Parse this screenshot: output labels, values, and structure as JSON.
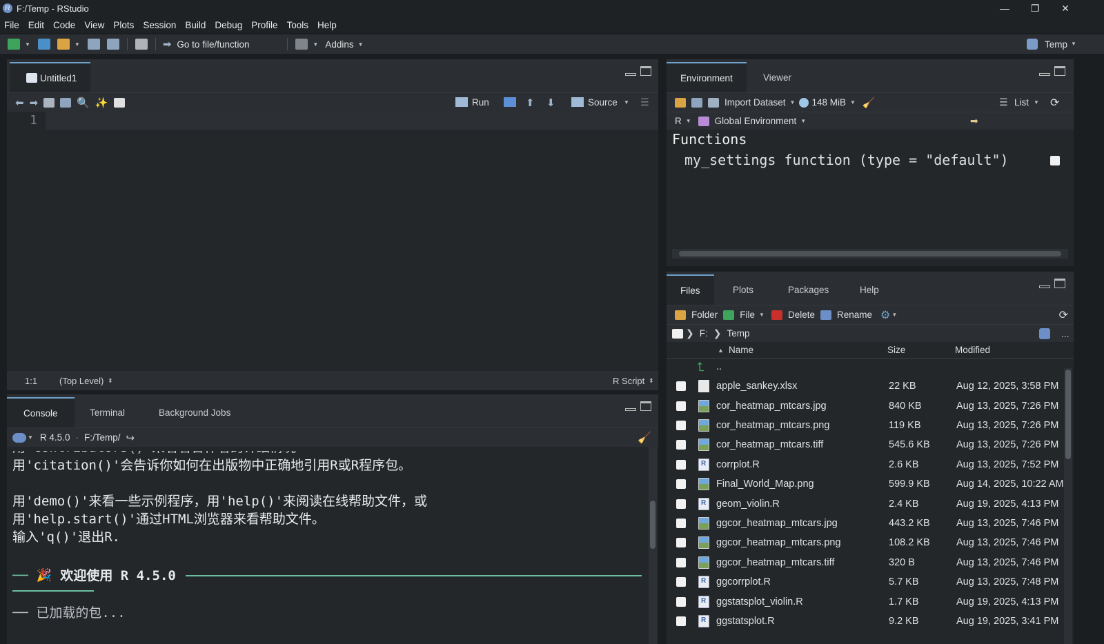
{
  "window": {
    "title": "F:/Temp - RStudio",
    "logo": "R"
  },
  "menu": [
    "File",
    "Edit",
    "Code",
    "View",
    "Plots",
    "Session",
    "Build",
    "Debug",
    "Profile",
    "Tools",
    "Help"
  ],
  "toolbar": {
    "goto_label": "Go to file/function",
    "addins_label": "Addins",
    "project_label": "Temp"
  },
  "editor": {
    "tab_label": "Untitled1",
    "run_label": "Run",
    "source_label": "Source",
    "line_number": "1",
    "cursor_pos": "1:1",
    "scope": "(Top Level)",
    "file_type": "R Script"
  },
  "console": {
    "tabs": [
      "Console",
      "Terminal",
      "Background Jobs"
    ],
    "r_version": "R 4.5.0",
    "path": "F:/Temp/",
    "lines": [
      "用'contributors()'来看看合作者的详细情况",
      "用'citation()'会告诉你如何在出版物中正确地引用R或R程序包。",
      "",
      "用'demo()'来看一些示例程序，用'help()'来阅读在线帮助文件，或",
      "用'help.start()'通过HTML浏览器来看帮助文件。",
      "输入'q()'退出R."
    ],
    "welcome_prefix": "──",
    "welcome_text": "欢迎使用 R 4.5.0",
    "welcome_icon": "party-icon",
    "last_line": "── 已加载的包..."
  },
  "environment": {
    "tabs": [
      "Environment",
      "Viewer"
    ],
    "import_label": "Import Dataset",
    "memory": "148 MiB",
    "list_label": "List",
    "lang": "R",
    "scope": "Global Environment",
    "section": "Functions",
    "row": "my_settings function (type = \"default\")"
  },
  "files": {
    "tabs": [
      "Files",
      "Plots",
      "Packages",
      "Help"
    ],
    "toolbar": {
      "folder": "Folder",
      "file": "File",
      "delete": "Delete",
      "rename": "Rename"
    },
    "breadcrumb": {
      "drive": "F:",
      "folder": "Temp"
    },
    "more": "...",
    "columns": {
      "name": "Name",
      "size": "Size",
      "modified": "Modified"
    },
    "parent": "..",
    "rows": [
      {
        "name": "apple_sankey.xlsx",
        "size": "22 KB",
        "modified": "Aug 12, 2025, 3:58 PM",
        "type": "xlsx"
      },
      {
        "name": "cor_heatmap_mtcars.jpg",
        "size": "840 KB",
        "modified": "Aug 13, 2025, 7:26 PM",
        "type": "img"
      },
      {
        "name": "cor_heatmap_mtcars.png",
        "size": "119 KB",
        "modified": "Aug 13, 2025, 7:26 PM",
        "type": "img"
      },
      {
        "name": "cor_heatmap_mtcars.tiff",
        "size": "545.6 KB",
        "modified": "Aug 13, 2025, 7:26 PM",
        "type": "img"
      },
      {
        "name": "corrplot.R",
        "size": "2.6 KB",
        "modified": "Aug 13, 2025, 7:52 PM",
        "type": "r"
      },
      {
        "name": "Final_World_Map.png",
        "size": "599.9 KB",
        "modified": "Aug 14, 2025, 10:22 AM",
        "type": "img"
      },
      {
        "name": "geom_violin.R",
        "size": "2.4 KB",
        "modified": "Aug 19, 2025, 4:13 PM",
        "type": "r"
      },
      {
        "name": "ggcor_heatmap_mtcars.jpg",
        "size": "443.2 KB",
        "modified": "Aug 13, 2025, 7:46 PM",
        "type": "img"
      },
      {
        "name": "ggcor_heatmap_mtcars.png",
        "size": "108.2 KB",
        "modified": "Aug 13, 2025, 7:46 PM",
        "type": "img"
      },
      {
        "name": "ggcor_heatmap_mtcars.tiff",
        "size": "320 B",
        "modified": "Aug 13, 2025, 7:46 PM",
        "type": "img"
      },
      {
        "name": "ggcorrplot.R",
        "size": "5.7 KB",
        "modified": "Aug 13, 2025, 7:48 PM",
        "type": "r"
      },
      {
        "name": "ggstatsplot_violin.R",
        "size": "1.7 KB",
        "modified": "Aug 19, 2025, 4:13 PM",
        "type": "r"
      },
      {
        "name": "ggstatsplot.R",
        "size": "9.2 KB",
        "modified": "Aug 19, 2025, 3:41 PM",
        "type": "r"
      }
    ]
  },
  "colors": {
    "accent": "#6fa1c9",
    "background": "#23272a",
    "chrome": "#2b2f33",
    "welcome_rule": "#6bbfa0"
  }
}
